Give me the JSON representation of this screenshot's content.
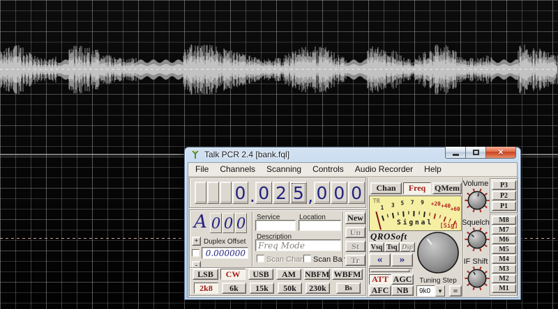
{
  "window": {
    "title": "Talk PCR 2.4 [bank.fql]",
    "menu": [
      "File",
      "Channels",
      "Scanning",
      "Controls",
      "Audio Recorder",
      "Help"
    ]
  },
  "freq": {
    "value": "0.025,000",
    "cells": [
      "",
      "",
      "",
      "0",
      ".",
      "0",
      "2",
      "5",
      ",",
      "0",
      "0",
      "0"
    ],
    "focused_cell": 7
  },
  "channel": {
    "letter": "A",
    "digits": [
      "0",
      "0",
      "0"
    ]
  },
  "duplex": {
    "plus_label": "+",
    "minus_label": "-",
    "label": "Duplex Offset",
    "value": "0.000000"
  },
  "fields": {
    "service_label": "Service",
    "service_value": "",
    "location_label": "Location",
    "location_value": "",
    "description_label": "Description",
    "description_value": "Freq Mode",
    "scan_chan": "Scan Chan",
    "scan_bank": "Scan Bank"
  },
  "record_buttons": {
    "new": "New",
    "un": "Un",
    "st": "St",
    "tr": "Tr"
  },
  "display_tabs": {
    "chan": "Chan",
    "freq": "Freq",
    "qmem": "QMem",
    "active": "Freq"
  },
  "meter": {
    "tr": "TR",
    "ticks": [
      "1",
      "3",
      "5",
      "7",
      "9",
      "+20",
      "+40",
      "+60"
    ],
    "label": "Signal",
    "sig": "[Sig]"
  },
  "brand": "QROSoft",
  "squelch_tabs": {
    "vsq": "Vsq",
    "tsq": "Tsq",
    "dsp": "Dsp"
  },
  "step_arrows": {
    "down": "«",
    "up": "»"
  },
  "toggles": {
    "att": "ATT",
    "agc": "AGC",
    "afc": "AFC",
    "nb": "NB"
  },
  "tuning": {
    "label": "Tuning Step",
    "value": "9k0",
    "equals": "="
  },
  "knobs": {
    "volume": "Volume",
    "squelch": "Squelch",
    "if_shift": "IF Shift"
  },
  "presets": [
    "P3",
    "P2",
    "P1"
  ],
  "memories": [
    "M8",
    "M7",
    "M6",
    "M5",
    "M4",
    "M3",
    "M2",
    "M1"
  ],
  "modes": [
    "LSB",
    "CW",
    "USB",
    "AM",
    "NBFM",
    "WBFM"
  ],
  "filters": [
    "2k8",
    "6k",
    "15k",
    "50k",
    "230k"
  ],
  "bandscope": "Bs",
  "active": {
    "mode": "CW",
    "filter": "2k8",
    "tab": "Freq"
  },
  "colors": {
    "meter_bg": "#f4efa3",
    "active_red": "#a21d16",
    "digit_navy": "#23237f",
    "aero_frame": "#b6cde6"
  }
}
